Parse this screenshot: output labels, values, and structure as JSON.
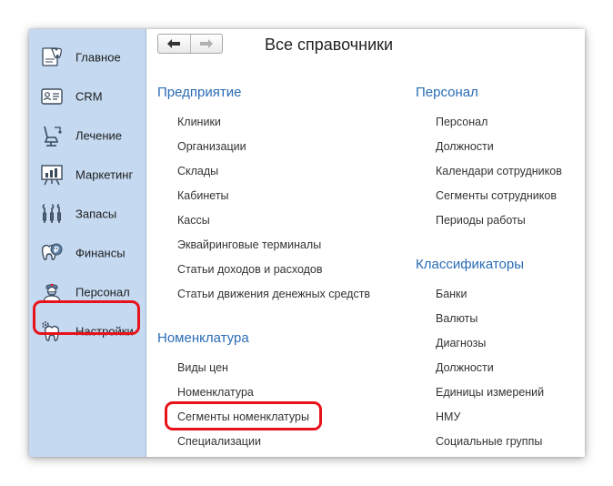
{
  "sidebar": {
    "items": [
      {
        "label": "Главное",
        "icon": "home-tooth-icon"
      },
      {
        "label": "CRM",
        "icon": "id-card-icon"
      },
      {
        "label": "Лечение",
        "icon": "dental-chair-icon"
      },
      {
        "label": "Маркетинг",
        "icon": "chart-board-icon"
      },
      {
        "label": "Запасы",
        "icon": "dental-tools-icon"
      },
      {
        "label": "Финансы",
        "icon": "tooth-coin-icon"
      },
      {
        "label": "Персонал",
        "icon": "doctor-icon"
      },
      {
        "label": "Настройки",
        "icon": "tooth-gear-icon"
      }
    ]
  },
  "header": {
    "title": "Все справочники",
    "back_icon": "arrow-left-icon",
    "forward_icon": "arrow-right-icon"
  },
  "sections": {
    "enterprise": {
      "title": "Предприятие",
      "links": [
        "Клиники",
        "Организации",
        "Склады",
        "Кабинеты",
        "Кассы",
        "Эквайринговые терминалы",
        "Статьи доходов и расходов",
        "Статьи движения денежных средств"
      ]
    },
    "nomenclature": {
      "title": "Номенклатура",
      "links": [
        "Виды цен",
        "Номенклатура",
        "Сегменты номенклатуры",
        "Специализации"
      ]
    },
    "personnel": {
      "title": "Персонал",
      "links": [
        "Персонал",
        "Должности",
        "Календари сотрудников",
        "Сегменты сотрудников",
        "Периоды работы"
      ]
    },
    "classifiers": {
      "title": "Классификаторы",
      "links": [
        "Банки",
        "Валюты",
        "Диагнозы",
        "Должности",
        "Единицы измерений",
        "НМУ",
        "Социальные группы"
      ]
    }
  },
  "colors": {
    "sidebar_bg": "#c5d9f1",
    "section_title": "#2a6cb6",
    "highlight": "#e8121b"
  }
}
